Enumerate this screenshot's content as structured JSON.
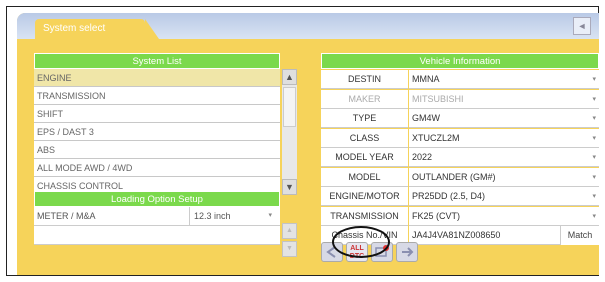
{
  "window": {
    "tab_title": "System select",
    "back_icon": "◄"
  },
  "system_list": {
    "header": "System List",
    "items": [
      "ENGINE",
      "TRANSMISSION",
      "SHIFT",
      "EPS / DAST 3",
      "ABS",
      "ALL MODE AWD / 4WD",
      "CHASSIS CONTROL"
    ],
    "selected_index": 0,
    "scroll_up": "▲",
    "scroll_down": "▼"
  },
  "loading_option": {
    "header": "Loading Option Setup",
    "rows": [
      {
        "name": "METER / M&A",
        "value": "12.3 inch",
        "dropdown": "▾"
      }
    ],
    "scroll_up": "▲",
    "scroll_down": "▼"
  },
  "vehicle_info": {
    "header": "Vehicle Information",
    "rows": [
      {
        "label": "DESTIN",
        "value": "MMNA"
      },
      {
        "label": "MAKER",
        "value": "MITSUBISHI"
      },
      {
        "label": "TYPE",
        "value": "GM4W"
      },
      {
        "label": "CLASS",
        "value": "XTUCZL2M"
      },
      {
        "label": "MODEL YEAR",
        "value": "2022"
      },
      {
        "label": "MODEL",
        "value": "OUTLANDER (GM#)"
      },
      {
        "label": "ENGINE/MOTOR",
        "value": "PR25DD (2.5, D4)"
      },
      {
        "label": "TRANSMISSION",
        "value": "FK25 (CVT)"
      },
      {
        "label": "Chassis No./VIN",
        "value": "JA4J4VA81NZ008650"
      }
    ],
    "match_button": "Match",
    "dropdown": "▾"
  },
  "bottom_buttons": {
    "all_dtc": "ALL\nDTC"
  },
  "colors": {
    "panel_green": "#7bd94c",
    "background": "#f6d35a"
  }
}
